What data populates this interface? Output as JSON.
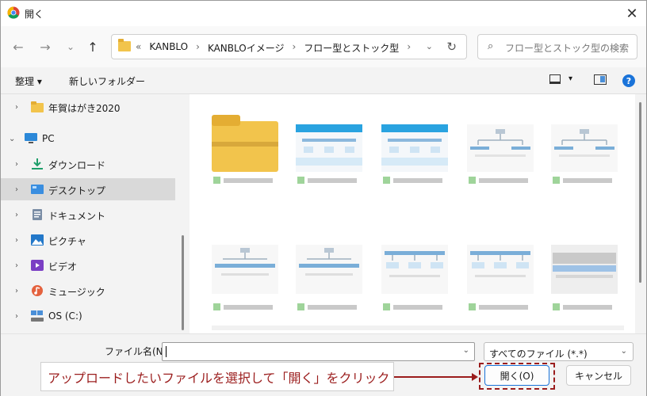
{
  "window": {
    "title": "開く",
    "close_glyph": "✕"
  },
  "nav": {
    "back": "←",
    "forward": "→",
    "recent": "⌄",
    "up": "↑"
  },
  "address": {
    "crumbs": [
      "«",
      "KANBLO",
      "›",
      "KANBLOイメージ",
      "›",
      "フロー型とストック型",
      "›"
    ],
    "chevron": "⌄",
    "refresh": "↻"
  },
  "search": {
    "placeholder": "フロー型とストック型の検索",
    "icon": "⌕"
  },
  "toolbar": {
    "organize": "整理 ▾",
    "new_folder": "新しいフォルダー",
    "view_dd": "▾",
    "help": "?"
  },
  "sidebar": {
    "items": [
      {
        "chev": "›",
        "label": "年賀はがき2020",
        "icon": "folder-icon"
      },
      {
        "chev": "⌄",
        "label": "PC",
        "icon": "pc-icon"
      },
      {
        "chev": "›",
        "label": "ダウンロード",
        "icon": "download-icon"
      },
      {
        "chev": "›",
        "label": "デスクトップ",
        "icon": "desktop-icon"
      },
      {
        "chev": "›",
        "label": "ドキュメント",
        "icon": "document-icon"
      },
      {
        "chev": "›",
        "label": "ピクチャ",
        "icon": "pictures-icon"
      },
      {
        "chev": "›",
        "label": "ビデオ",
        "icon": "video-icon"
      },
      {
        "chev": "›",
        "label": "ミュージック",
        "icon": "music-icon"
      },
      {
        "chev": "›",
        "label": "OS (C:)",
        "icon": "drive-icon"
      }
    ]
  },
  "bottom": {
    "filename_label": "ファイル名(N):",
    "filename_value": "",
    "filetype": "すべてのファイル (*.*)",
    "dd": "⌄",
    "open": "開く(O)",
    "cancel": "キャンセル"
  },
  "annotation": {
    "text": "アップロードしたいファイルを選択して「開く」をクリック"
  },
  "colors": {
    "accent": "#1a73d9",
    "annotation": "#9b1d1d",
    "folder": "#f2c44c"
  }
}
